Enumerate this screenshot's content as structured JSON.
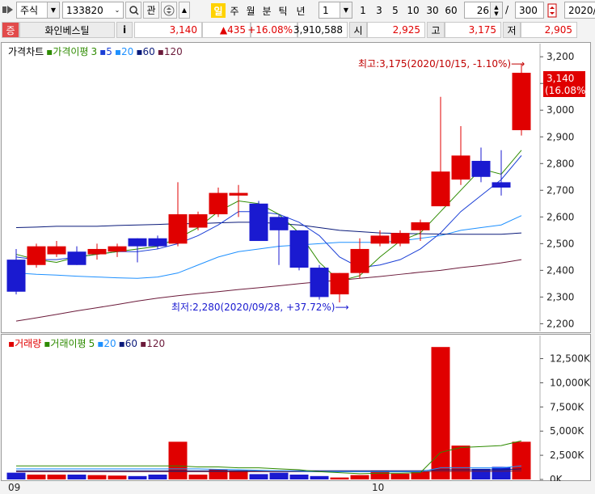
{
  "toolbar": {
    "market": "주식",
    "code": "133820",
    "watch": "관",
    "period_tabs": [
      "일",
      "주",
      "월",
      "분",
      "틱",
      "년"
    ],
    "selected_period": "일",
    "unit_value": "1",
    "intervals": [
      "1",
      "3",
      "5",
      "10",
      "30",
      "60"
    ],
    "count_value": "26",
    "slash": "/",
    "total_value": "300",
    "date_value": "2020/"
  },
  "quote": {
    "badge": "증",
    "name": "화인베스틸",
    "info": "i",
    "price": "3,140",
    "change": "▲435",
    "change_pct": "+16.08%",
    "volume": "3,910,588",
    "open_label": "시",
    "open": "2,925",
    "high_label": "고",
    "high": "3,175",
    "low_label": "저",
    "low": "2,905"
  },
  "price_panel": {
    "title": "가격차트",
    "ma_title": "가격이평",
    "ma_periods": [
      "3",
      "5",
      "20",
      "60",
      "120"
    ],
    "ma_colors": [
      "#2e8b00",
      "#1b3fd6",
      "#1e90ff",
      "#0a1a7a",
      "#6b1a3a"
    ],
    "high_note": "최고:3,175(2020/10/15, -1.10%)⟶",
    "low_note": "최저:2,280(2020/09/28, +37.72%)⟶",
    "last_price": "3,140",
    "last_pct": "(16.08%)",
    "y_ticks": [
      "3,200",
      "3,100",
      "3,000",
      "2,900",
      "2,800",
      "2,700",
      "2,600",
      "2,500",
      "2,400",
      "2,300",
      "2,200"
    ]
  },
  "volume_panel": {
    "title": "거래량",
    "ma_title": "거래이평",
    "ma_periods": [
      "5",
      "20",
      "60",
      "120"
    ],
    "y_ticks": [
      "12,500K",
      "10,000K",
      "7,500K",
      "5,000K",
      "2,500K",
      "0K"
    ]
  },
  "x_labels": [
    "09",
    "10"
  ],
  "chart_data": {
    "type": "candlestick",
    "y_range": [
      2180,
      3240
    ],
    "candles": [
      {
        "o": 2440,
        "h": 2480,
        "l": 2310,
        "c": 2320
      },
      {
        "o": 2420,
        "h": 2500,
        "l": 2410,
        "c": 2490
      },
      {
        "o": 2460,
        "h": 2510,
        "l": 2450,
        "c": 2490
      },
      {
        "o": 2470,
        "h": 2490,
        "l": 2420,
        "c": 2420
      },
      {
        "o": 2460,
        "h": 2500,
        "l": 2440,
        "c": 2480
      },
      {
        "o": 2470,
        "h": 2500,
        "l": 2450,
        "c": 2490
      },
      {
        "o": 2520,
        "h": 2520,
        "l": 2430,
        "c": 2490
      },
      {
        "o": 2520,
        "h": 2530,
        "l": 2480,
        "c": 2490
      },
      {
        "o": 2500,
        "h": 2730,
        "l": 2490,
        "c": 2610
      },
      {
        "o": 2560,
        "h": 2620,
        "l": 2550,
        "c": 2610
      },
      {
        "o": 2610,
        "h": 2710,
        "l": 2600,
        "c": 2690
      },
      {
        "o": 2680,
        "h": 2720,
        "l": 2600,
        "c": 2690
      },
      {
        "o": 2650,
        "h": 2660,
        "l": 2520,
        "c": 2510
      },
      {
        "o": 2600,
        "h": 2610,
        "l": 2420,
        "c": 2550
      },
      {
        "o": 2550,
        "h": 2550,
        "l": 2400,
        "c": 2410
      },
      {
        "o": 2410,
        "h": 2420,
        "l": 2290,
        "c": 2300
      },
      {
        "o": 2310,
        "h": 2390,
        "l": 2280,
        "c": 2390
      },
      {
        "o": 2390,
        "h": 2520,
        "l": 2370,
        "c": 2480
      },
      {
        "o": 2500,
        "h": 2550,
        "l": 2490,
        "c": 2530
      },
      {
        "o": 2500,
        "h": 2550,
        "l": 2490,
        "c": 2540
      },
      {
        "o": 2550,
        "h": 2590,
        "l": 2510,
        "c": 2580
      },
      {
        "o": 2640,
        "h": 3050,
        "l": 2640,
        "c": 2770
      },
      {
        "o": 2740,
        "h": 2940,
        "l": 2720,
        "c": 2830
      },
      {
        "o": 2810,
        "h": 2860,
        "l": 2730,
        "c": 2750
      },
      {
        "o": 2730,
        "h": 2850,
        "l": 2680,
        "c": 2710
      },
      {
        "o": 2925,
        "h": 3175,
        "l": 2905,
        "c": 3140
      }
    ],
    "ma3": [
      2460,
      2440,
      2430,
      2450,
      2460,
      2470,
      2480,
      2490,
      2520,
      2560,
      2620,
      2660,
      2650,
      2610,
      2540,
      2430,
      2360,
      2380,
      2450,
      2510,
      2540,
      2620,
      2700,
      2780,
      2760,
      2850
    ],
    "ma5": [
      2450,
      2440,
      2440,
      2450,
      2460,
      2470,
      2470,
      2480,
      2500,
      2530,
      2570,
      2620,
      2620,
      2610,
      2580,
      2530,
      2450,
      2410,
      2420,
      2440,
      2480,
      2540,
      2620,
      2680,
      2740,
      2830
    ],
    "ma20": [
      2560,
      2562,
      2565,
      2565,
      2565,
      2568,
      2570,
      2572,
      2575,
      2575,
      2578,
      2580,
      2580,
      2575,
      2570,
      2560,
      2550,
      2545,
      2540,
      2538,
      2537,
      2536,
      2535,
      2535,
      2535,
      2540
    ],
    "ma60": [
      2390,
      2385,
      2382,
      2378,
      2375,
      2372,
      2370,
      2375,
      2390,
      2420,
      2450,
      2470,
      2480,
      2490,
      2495,
      2500,
      2505,
      2505,
      2505,
      2510,
      2520,
      2530,
      2550,
      2560,
      2570,
      2605
    ],
    "ma120": [
      2210,
      2222,
      2235,
      2248,
      2260,
      2272,
      2285,
      2296,
      2305,
      2313,
      2320,
      2328,
      2335,
      2342,
      2350,
      2357,
      2363,
      2370,
      2377,
      2385,
      2393,
      2400,
      2410,
      2418,
      2428,
      2440
    ],
    "volume_range": [
      0,
      13800
    ],
    "volumes": [
      700,
      500,
      500,
      500,
      450,
      400,
      350,
      500,
      3900,
      500,
      1050,
      900,
      550,
      700,
      500,
      350,
      200,
      450,
      900,
      600,
      800,
      13700,
      3500,
      1100,
      1300,
      3900
    ],
    "vol_ma5": [
      1400,
      1400,
      1400,
      1400,
      1400,
      1400,
      1400,
      1400,
      1400,
      1300,
      1300,
      1200,
      1200,
      1100,
      1000,
      800,
      700,
      600,
      650,
      650,
      700,
      2800,
      3300,
      3400,
      3500,
      4000
    ],
    "vol_ma20": [
      1100,
      1100,
      1100,
      1100,
      1100,
      1100,
      1100,
      1100,
      1100,
      1100,
      1050,
      1000,
      950,
      900,
      850,
      800,
      800,
      800,
      800,
      800,
      800,
      1200,
      1200,
      1200,
      1200,
      1400
    ],
    "vol_ma60": [
      900,
      900,
      900,
      900,
      900,
      900,
      900,
      900,
      900,
      900,
      900,
      900,
      900,
      900,
      900,
      900,
      900,
      900,
      900,
      900,
      900,
      1000,
      1000,
      1000,
      1000,
      1100
    ],
    "vol_ma120": [
      800,
      800,
      800,
      800,
      800,
      800,
      800,
      800,
      800,
      800,
      800,
      800,
      800,
      800,
      800,
      800,
      800,
      800,
      800,
      800,
      800,
      850,
      850,
      850,
      850,
      900
    ]
  }
}
